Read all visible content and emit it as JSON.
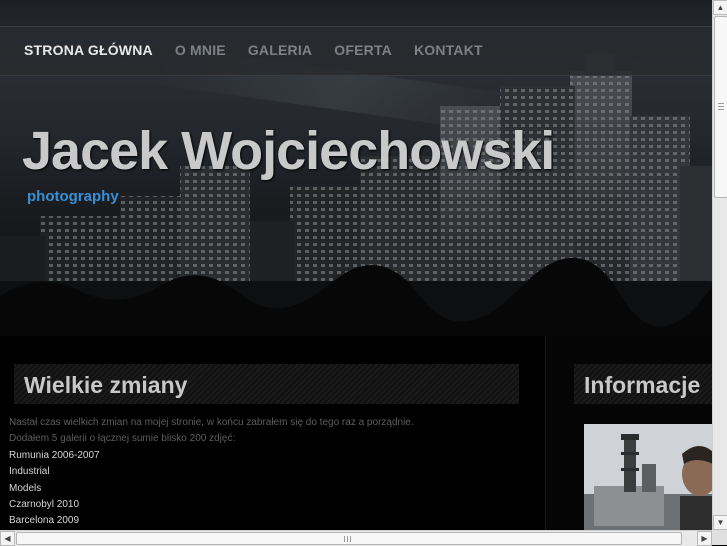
{
  "nav": {
    "items": [
      {
        "label": "STRONA GŁÓWNA",
        "active": true
      },
      {
        "label": "O MNIE",
        "active": false
      },
      {
        "label": "GALERIA",
        "active": false
      },
      {
        "label": "OFERTA",
        "active": false
      },
      {
        "label": "KONTAKT",
        "active": false
      }
    ]
  },
  "header": {
    "title": "Jacek Wojciechowski",
    "subtitle": "photography"
  },
  "main": {
    "heading": "Wielkie zmiany",
    "lines": [
      "Nastał czas wielkich zmian na mojej stronie, w końcu zabrałem się do tego raz a porządnie.",
      "Dodałem 5 galerii o łącznej sumie blisko 200 zdjęć:",
      "Rumunia 2006-2007",
      "Industrial",
      "Models",
      "Czarnobyl 2010",
      "Barcelona 2009"
    ]
  },
  "sidebar": {
    "heading": "Informacje"
  },
  "colors": {
    "accent": "#3b8fd6",
    "nav_active": "#e8e8e8",
    "nav_inactive": "#7d8288"
  },
  "icons": {
    "scroll_up": "▲",
    "scroll_down": "▼",
    "scroll_left": "◀",
    "scroll_right": "▶"
  }
}
